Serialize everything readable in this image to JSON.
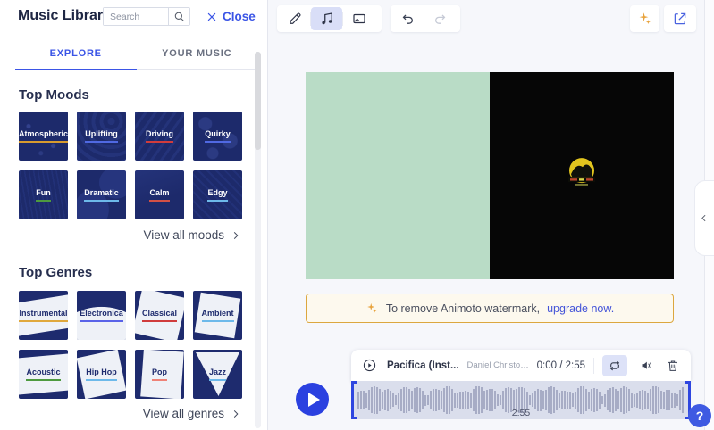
{
  "left_panel": {
    "title": "Music Library",
    "search": {
      "placeholder": "Search"
    },
    "close_label": "Close",
    "tabs": {
      "explore": "EXPLORE",
      "your_music": "YOUR MUSIC"
    },
    "moods": {
      "heading": "Top Moods",
      "view_all_label": "View all moods",
      "items": [
        {
          "label": "Atmospheric",
          "underline_color": "#d79b2f"
        },
        {
          "label": "Uplifting",
          "underline_color": "#5069e2"
        },
        {
          "label": "Driving",
          "underline_color": "#d03c3c"
        },
        {
          "label": "Quirky",
          "underline_color": "#5069e2"
        },
        {
          "label": "Fun",
          "underline_color": "#4e9a3f"
        },
        {
          "label": "Dramatic",
          "underline_color": "#6db9ea"
        },
        {
          "label": "Calm",
          "underline_color": "#d25045"
        },
        {
          "label": "Edgy",
          "underline_color": "#6db9ea"
        }
      ]
    },
    "genres": {
      "heading": "Top Genres",
      "view_all_label": "View all genres",
      "items": [
        {
          "label": "Instrumental",
          "underline_color": "#e0a83c"
        },
        {
          "label": "Electronica",
          "underline_color": "#5a63e8"
        },
        {
          "label": "Classical",
          "underline_color": "#d03c3c"
        },
        {
          "label": "Ambient",
          "underline_color": "#6db9ea"
        },
        {
          "label": "Acoustic",
          "underline_color": "#4e9a3f"
        },
        {
          "label": "Hip Hop",
          "underline_color": "#6db9ea"
        },
        {
          "label": "Pop",
          "underline_color": "#ef8277"
        },
        {
          "label": "Jazz",
          "underline_color": "#6db9ea"
        }
      ]
    }
  },
  "banner": {
    "text": "To remove Animoto watermark,",
    "link_label": "upgrade now."
  },
  "audio": {
    "title": "Pacifica (Inst...",
    "artist": "Daniel Christopher O'Donnel...",
    "time": "0:00 / 2:55",
    "duration_label": "2:55"
  },
  "help": {
    "label": "?"
  },
  "icons": {
    "search-icon": "magnifier",
    "close-icon": "x-cross",
    "pencil-icon": "pencil",
    "music-note-icon": "double-note",
    "media-frame-icon": "frame",
    "undo-icon": "curved-arrow-left",
    "redo-icon": "curved-arrow-right",
    "sparkle-icon": "four-point-star",
    "export-icon": "box-arrow-out",
    "track-play-icon": "circled-play",
    "loop-icon": "repeat-arrows",
    "volume-icon": "speaker",
    "trash-icon": "bin",
    "chevron-right-icon": "›",
    "chevron-left-icon": "‹",
    "big-play-icon": "play-triangle"
  },
  "colors": {
    "accent_blue": "#3b55e6",
    "tile_navy": "#1d2a6b",
    "banner_border": "#dca73f",
    "banner_bg": "#fdf9ee",
    "preview_green": "#b9dcc6",
    "play_button_blue": "#2b41e0",
    "waveform_bg": "#dadeec",
    "waveform_bar": "#a7acc5",
    "selection_blue": "#2e46e0"
  }
}
